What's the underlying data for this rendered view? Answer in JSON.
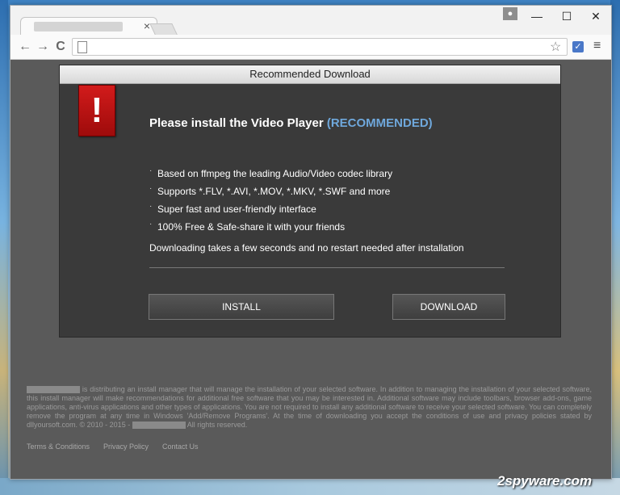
{
  "browser": {
    "tab_close": "×",
    "window_controls": {
      "minimize": "—",
      "maximize": "☐",
      "close": "✕"
    },
    "nav": {
      "back": "←",
      "forward": "→",
      "reload": "C"
    },
    "icons": [
      "page-icon",
      "star-icon",
      "extension-icon",
      "menu-icon"
    ]
  },
  "dialog": {
    "title": "Recommended Download",
    "headline": "Please install the Video Player",
    "headline_tag": "(RECOMMENDED)",
    "features": [
      "Based on ffmpeg the leading Audio/Video codec library",
      "Supports *.FLV, *.AVI, *.MOV, *.MKV, *.SWF and more",
      "Super fast and user-friendly interface",
      "100% Free & Safe-share it with your friends"
    ],
    "note": "Downloading takes a few seconds and no restart needed after installation",
    "install_label": "INSTALL",
    "download_label": "DOWNLOAD"
  },
  "disclaimer": {
    "part1": "is distributing an install manager that will manage the installation of your selected software. In addition to managing the installation of your selected software, this install manager will make recommendations for additional free software that you may be interested in. Additional software may include toolbars, browser add-ons, game applications, anti-virus applications and other types of applications. You are not required to install any additional software to receive your selected software. You can completely remove the program at any time in Windows 'Add/Remove Programs'. At the time of downloading you accept the conditions of use and privacy policies stated by dllyoursoft.com. © 2010 - 2015 -",
    "part2": "All rights reserved."
  },
  "footer": {
    "terms": "Terms & Conditions",
    "privacy": "Privacy Policy",
    "contact": "Contact Us"
  },
  "watermark": "2spyware.com",
  "colors": {
    "accent": "#6fa8dc",
    "dialog_bg": "#3a3a3a",
    "alert_red": "#c81414"
  }
}
